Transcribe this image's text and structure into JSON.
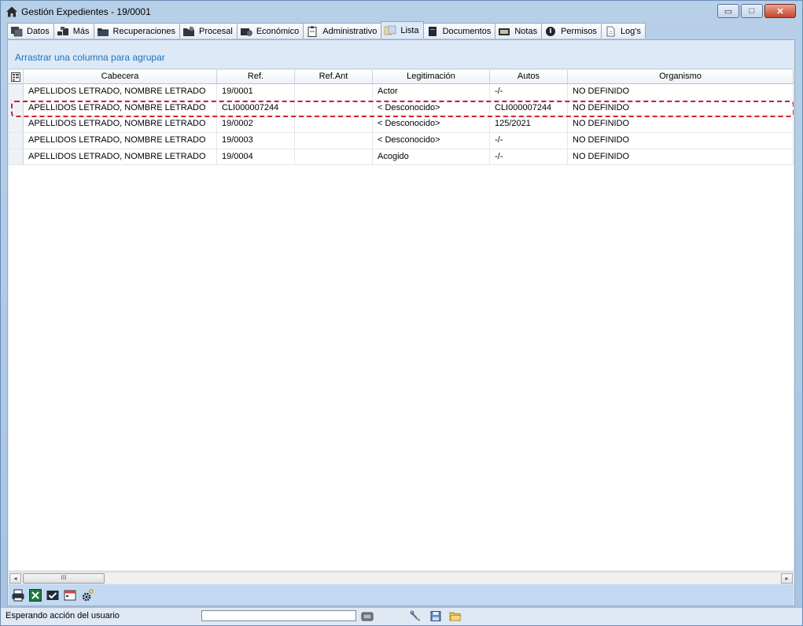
{
  "window": {
    "title": "Gestión Expedientes - 19/0001",
    "controls": {
      "minimize": "▭",
      "maximize": "□",
      "close": "✕"
    }
  },
  "tabs": [
    {
      "label": "Datos",
      "icon": "datos-icon"
    },
    {
      "label": "Más",
      "icon": "mas-icon"
    },
    {
      "label": "Recuperaciones",
      "icon": "folder-icon"
    },
    {
      "label": "Procesal",
      "icon": "procesal-icon"
    },
    {
      "label": "Económico",
      "icon": "economico-icon"
    },
    {
      "label": "Administrativo",
      "icon": "clipboard-icon"
    },
    {
      "label": "Lista",
      "icon": "lista-icon",
      "active": true
    },
    {
      "label": "Documentos",
      "icon": "book-icon"
    },
    {
      "label": "Notas",
      "icon": "notas-icon"
    },
    {
      "label": "Permisos",
      "icon": "permisos-icon"
    },
    {
      "label": "Log's",
      "icon": "document-icon"
    }
  ],
  "group_hint": "Arrastrar una columna para agrupar",
  "grid": {
    "columns": [
      "Cabecera",
      "Ref.",
      "Ref.Ant",
      "Legitimación",
      "Autos",
      "Organismo"
    ],
    "rows": [
      {
        "cabecera": "APELLIDOS LETRADO, NOMBRE LETRADO",
        "ref": "19/0001",
        "ref_ant": "",
        "legitimacion": "Actor",
        "autos": "-/-",
        "organismo": "NO DEFINIDO"
      },
      {
        "cabecera": "APELLIDOS LETRADO, NOMBRE LETRADO",
        "ref": "CLI000007244",
        "ref_ant": "",
        "legitimacion": "< Desconocido>",
        "autos": "CLI000007244",
        "organismo": "NO DEFINIDO",
        "highlighted": true
      },
      {
        "cabecera": "APELLIDOS LETRADO, NOMBRE LETRADO",
        "ref": "19/0002",
        "ref_ant": "",
        "legitimacion": "< Desconocido>",
        "autos": "125/2021",
        "organismo": "NO DEFINIDO"
      },
      {
        "cabecera": "APELLIDOS LETRADO, NOMBRE LETRADO",
        "ref": "19/0003",
        "ref_ant": "",
        "legitimacion": "< Desconocido>",
        "autos": "-/-",
        "organismo": "NO DEFINIDO"
      },
      {
        "cabecera": "APELLIDOS LETRADO, NOMBRE LETRADO",
        "ref": "19/0004",
        "ref_ant": "",
        "legitimacion": "Acogido",
        "autos": "-/-",
        "organismo": "NO DEFINIDO"
      }
    ]
  },
  "scrollbar": {
    "left": "◂",
    "right": "▸",
    "thumb": "III"
  },
  "grid_toolbar": [
    "print-icon",
    "excel-icon",
    "check-icon",
    "calendar-icon",
    "settings-icon"
  ],
  "status": {
    "text": "Esperando acción del usuario",
    "icons": [
      "db-icon",
      "tools-icon",
      "save-icon",
      "open-folder-icon"
    ]
  },
  "colors": {
    "highlight_outline": "#d0222a",
    "group_hint": "#1e73be",
    "window_frame": "#a9c3e1"
  }
}
